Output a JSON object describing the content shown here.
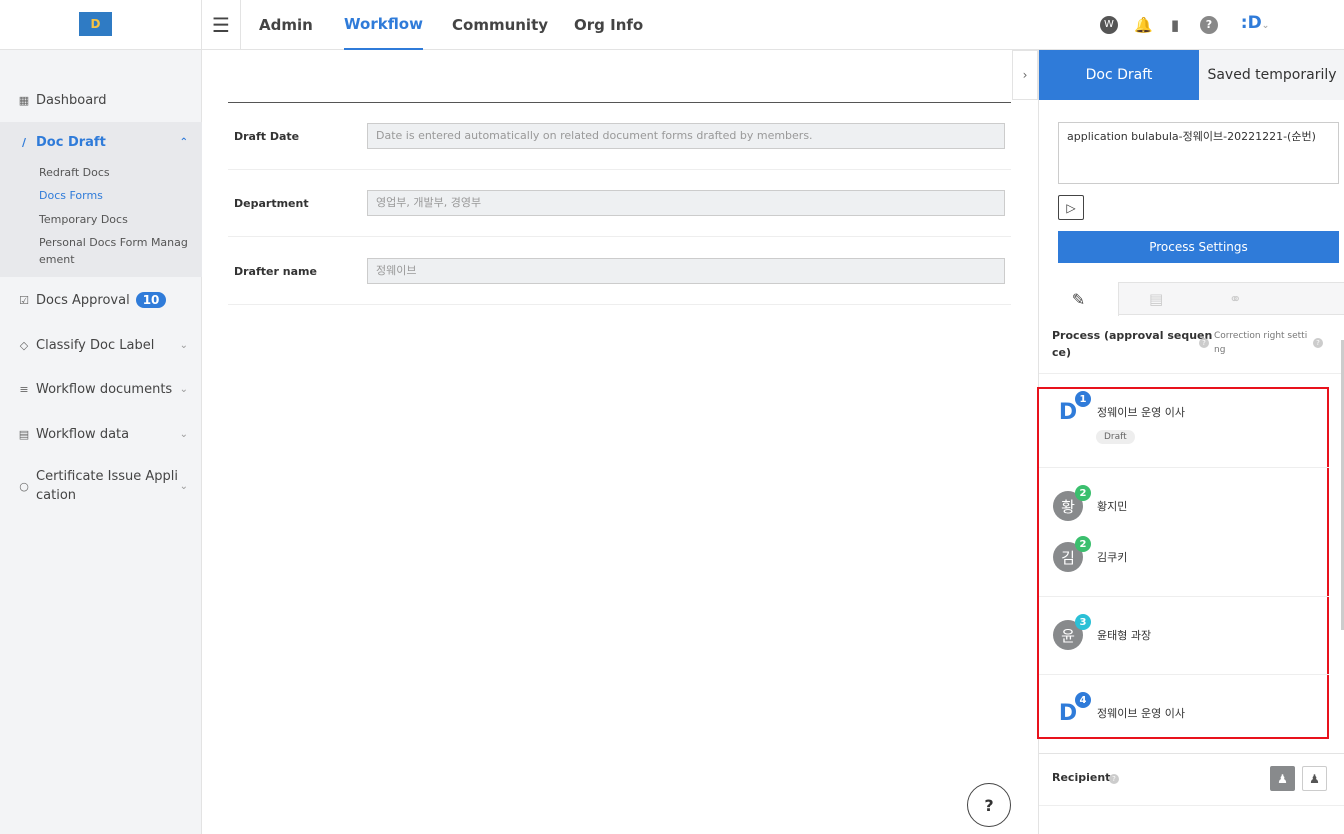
{
  "header": {
    "logo": "D",
    "nav": [
      "Admin",
      "Workflow",
      "Community",
      "Org Info"
    ]
  },
  "sidebar": {
    "dashboard": "Dashboard",
    "doc_draft": "Doc Draft",
    "subs": [
      "Redraft Docs",
      "Docs Forms",
      "Temporary Docs",
      "Personal Docs Form Manag",
      "ement"
    ],
    "approval": "Docs Approval",
    "approval_count": "10",
    "classify": "Classify Doc Label",
    "wf_docs": "Workflow documents",
    "wf_data": "Workflow data",
    "cert1": "Certificate Issue Appli",
    "cert2": "cation"
  },
  "form": {
    "draft_date_label": "Draft Date",
    "draft_date_ph": "Date is entered automatically on related document forms drafted by members.",
    "dept_label": "Department",
    "dept_ph": "영업부, 개발부, 경영부",
    "drafter_label": "Drafter name",
    "drafter_ph": "정웨이브"
  },
  "panel": {
    "tab_active": "Doc Draft",
    "tab_saved": "Saved temporarily",
    "title_text": "application bulabula-정웨이브-20221221-(순번)",
    "process_settings": "Process Settings",
    "process_label1": "Process (approval sequen",
    "process_label2": "ce)",
    "correction1": "Correction right setti",
    "correction2": "ng",
    "recipient": "Recipient"
  },
  "approvers": [
    {
      "avatar": "D",
      "num": "1",
      "name": "정웨이브 운영 이사",
      "tag": "Draft"
    },
    {
      "avatar": "황",
      "num": "2",
      "name": "황지민"
    },
    {
      "avatar": "김",
      "num": "2",
      "name": "김쿠키"
    },
    {
      "avatar": "윤",
      "num": "3",
      "name": "윤태형 과장"
    },
    {
      "avatar": "D",
      "num": "4",
      "name": "정웨이브 운영 이사"
    }
  ],
  "colors": {
    "accent": "#2f7bd9",
    "highlight": "#e8121c"
  }
}
